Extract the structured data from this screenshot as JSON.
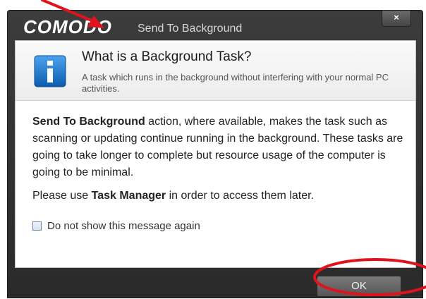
{
  "window": {
    "brand": "COMODO",
    "title": "Send To Background",
    "close_label": "×"
  },
  "header": {
    "title": "What is a Background Task?",
    "subtitle": "A task which runs in the background without interfering with your normal PC activities."
  },
  "body": {
    "para1_bold": "Send To Background",
    "para1_rest": " action, where available, makes the task such as scanning or updating continue running in the background. These tasks are going to take longer to complete but resource usage of the computer is going to be minimal.",
    "para2_pre": "Please use ",
    "para2_bold": "Task Manager",
    "para2_post": " in order to access them later."
  },
  "checkbox": {
    "label": "Do not show this message again",
    "checked": false
  },
  "footer": {
    "ok_label": "OK"
  },
  "annotations": {
    "highlight_color": "#e0121c"
  },
  "icons": {
    "info": "info-icon"
  }
}
